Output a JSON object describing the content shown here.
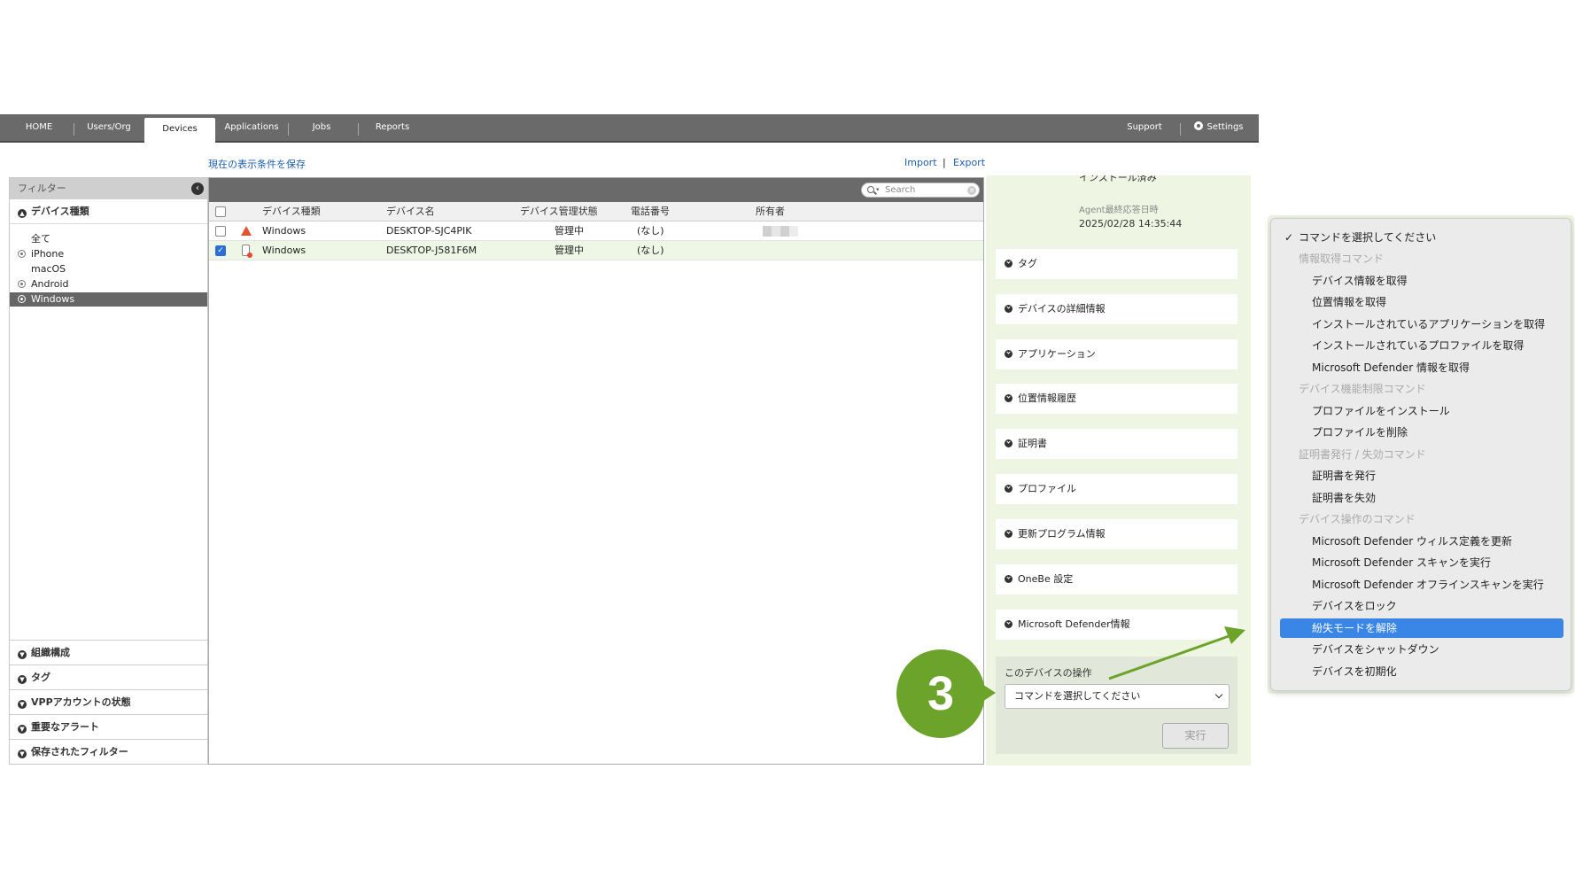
{
  "nav": {
    "tabs": [
      "HOME",
      "Users/Org",
      "Devices",
      "Applications",
      "Jobs",
      "Reports"
    ],
    "support": "Support",
    "settings": "Settings",
    "active": "Devices"
  },
  "links": {
    "save_view": "現在の表示条件を保存",
    "import": "Import",
    "separator": "|",
    "export": "Export"
  },
  "filter": {
    "title": "フィルター",
    "device_type_label": "デバイス種類",
    "device_types": [
      "全て",
      "iPhone",
      "macOS",
      "Android",
      "Windows"
    ],
    "selected": "Windows",
    "sections": [
      "組織構成",
      "タグ",
      "VPPアカウントの状態",
      "重要なアラート",
      "保存されたフィルター"
    ]
  },
  "list": {
    "search_placeholder": "Search",
    "columns": [
      "デバイス種類",
      "デバイス名",
      "デバイス管理状態",
      "電話番号",
      "所有者"
    ],
    "rows": [
      {
        "type": "Windows",
        "name": "DESKTOP-SJC4PIK",
        "status": "管理中",
        "phone": "(なし)",
        "checked": false
      },
      {
        "type": "Windows",
        "name": "DESKTOP-J581F6M",
        "status": "管理中",
        "phone": "(なし)",
        "checked": true
      }
    ]
  },
  "detail": {
    "install_status": "インストール済み",
    "agent_label": "Agent最終応答日時",
    "agent_time": "2025/02/28 14:35:44",
    "sections": [
      "タグ",
      "デバイスの詳細情報",
      "アプリケーション",
      "位置情報履歴",
      "証明書",
      "プロファイル",
      "更新プログラム情報",
      "OneBe 設定",
      "Microsoft Defender情報"
    ],
    "op_title": "このデバイスの操作",
    "select_value": "コマンドを選択してください",
    "run_label": "実行"
  },
  "step": "3",
  "menu": {
    "items": [
      {
        "kind": "first",
        "label": "コマンドを選択してください",
        "check": "✓"
      },
      {
        "kind": "group",
        "label": "情報取得コマンド"
      },
      {
        "kind": "opt",
        "label": "デバイス情報を取得"
      },
      {
        "kind": "opt",
        "label": "位置情報を取得"
      },
      {
        "kind": "opt",
        "label": "インストールされているアプリケーションを取得"
      },
      {
        "kind": "opt",
        "label": "インストールされているプロファイルを取得"
      },
      {
        "kind": "opt",
        "label": "Microsoft Defender 情報を取得"
      },
      {
        "kind": "group",
        "label": "デバイス機能制限コマンド"
      },
      {
        "kind": "opt",
        "label": "プロファイルをインストール"
      },
      {
        "kind": "opt",
        "label": "プロファイルを削除"
      },
      {
        "kind": "group",
        "label": "証明書発行 / 失効コマンド"
      },
      {
        "kind": "opt",
        "label": "証明書を発行"
      },
      {
        "kind": "opt",
        "label": "証明書を失効"
      },
      {
        "kind": "group",
        "label": "デバイス操作のコマンド"
      },
      {
        "kind": "opt",
        "label": "Microsoft Defender ウィルス定義を更新"
      },
      {
        "kind": "opt",
        "label": "Microsoft Defender スキャンを実行"
      },
      {
        "kind": "opt",
        "label": "Microsoft Defender オフラインスキャンを実行"
      },
      {
        "kind": "opt",
        "label": "デバイスをロック"
      },
      {
        "kind": "hl",
        "label": "紛失モードを解除"
      },
      {
        "kind": "opt",
        "label": "デバイスをシャットダウン"
      },
      {
        "kind": "opt",
        "label": "デバイスを初期化"
      }
    ]
  },
  "colors": {
    "nav_bg": "#6a6a6a",
    "accent_green": "#6ca32a",
    "highlight_blue": "#3a86e6",
    "link_blue": "#1d5fb3"
  }
}
